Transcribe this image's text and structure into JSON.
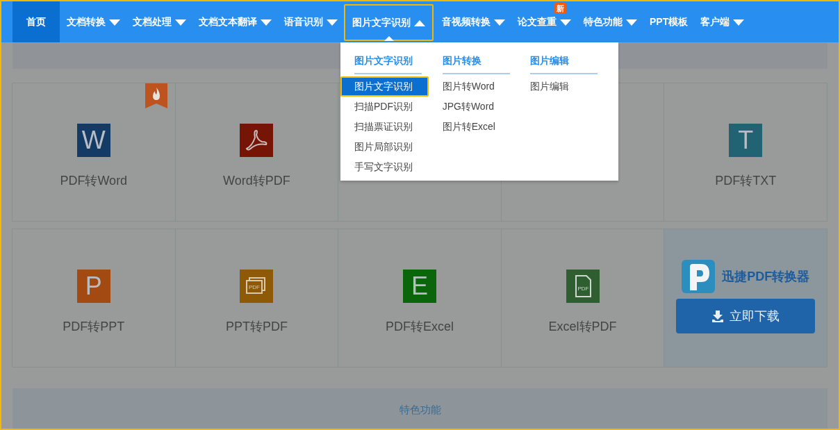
{
  "nav": [
    {
      "label": "首页",
      "kind": "link",
      "selected": true
    },
    {
      "label": "文档转换",
      "kind": "menu",
      "selected": false,
      "expanded": false
    },
    {
      "label": "文档处理",
      "kind": "menu",
      "selected": false,
      "expanded": false
    },
    {
      "label": "文档文本翻译",
      "kind": "menu",
      "selected": false,
      "expanded": false
    },
    {
      "label": "语音识别",
      "kind": "menu",
      "selected": false,
      "expanded": false
    },
    {
      "label": "图片文字识别",
      "kind": "menu",
      "selected": false,
      "expanded": true
    },
    {
      "label": "音视频转换",
      "kind": "menu",
      "selected": false,
      "expanded": false
    },
    {
      "label": "论文查重",
      "kind": "menu",
      "selected": false,
      "expanded": false,
      "badge": "新"
    },
    {
      "label": "特色功能",
      "kind": "menu",
      "selected": false,
      "expanded": false
    },
    {
      "label": "PPT模板",
      "kind": "link",
      "selected": false
    },
    {
      "label": "客户端",
      "kind": "menu",
      "selected": false,
      "expanded": false
    }
  ],
  "dropdown": {
    "columns": [
      {
        "title": "图片文字识别",
        "items": [
          {
            "label": "图片文字识别",
            "selected": true
          },
          {
            "label": "扫描PDF识别",
            "selected": false
          },
          {
            "label": "扫描票证识别",
            "selected": false
          },
          {
            "label": "图片局部识别",
            "selected": false
          },
          {
            "label": "手写文字识别",
            "selected": false
          }
        ]
      },
      {
        "title": "图片转换",
        "items": [
          {
            "label": "图片转Word",
            "selected": false
          },
          {
            "label": "JPG转Word",
            "selected": false
          },
          {
            "label": "图片转Excel",
            "selected": false
          }
        ]
      },
      {
        "title": "图片编辑",
        "items": [
          {
            "label": "图片编辑",
            "selected": false
          }
        ]
      }
    ]
  },
  "tiles": [
    {
      "kind": "letter",
      "label": "PDF转Word",
      "glyph": "W",
      "color": "#143a66",
      "hot": true
    },
    {
      "kind": "acrobat",
      "label": "Word转PDF",
      "color": "#761406",
      "hot": false
    },
    {
      "kind": "covered",
      "hot": false
    },
    {
      "kind": "covered",
      "hot": false
    },
    {
      "kind": "letter",
      "label": "PDF转TXT",
      "glyph": "T",
      "color": "#216373",
      "hot": false
    },
    {
      "kind": "letter",
      "label": "PDF转PPT",
      "glyph": "P",
      "color": "#a24a12",
      "hot": false
    },
    {
      "kind": "slides",
      "label": "PPT转PDF",
      "glyph": "PDF",
      "color": "#8f5a08",
      "hot": false
    },
    {
      "kind": "letter",
      "label": "PDF转Excel",
      "glyph": "E",
      "color": "#0b650b",
      "hot": false
    },
    {
      "kind": "file",
      "label": "Excel转PDF",
      "glyph": "PDF",
      "color": "#2f5e30",
      "hot": false
    },
    {
      "kind": "promo",
      "title": "迅捷PDF转换器",
      "button": "立即下载"
    }
  ],
  "footer_strip": {
    "label": "特色功能"
  }
}
